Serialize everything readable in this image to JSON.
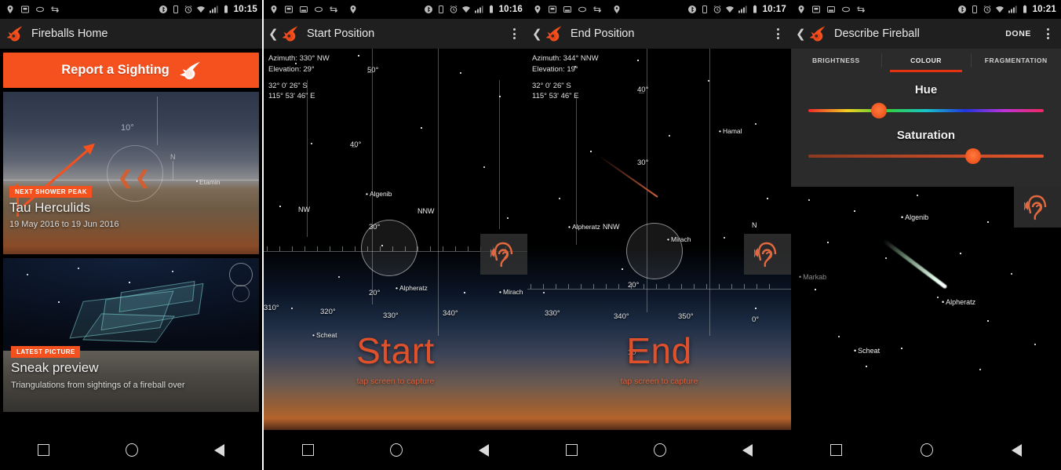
{
  "panels": [
    {
      "id": "fireballs-home",
      "statusbar": {
        "time": "10:15",
        "icons_left": [
          "location-icon",
          "sd-card-icon",
          "usb-icon",
          "sync-icon"
        ],
        "icons_right": [
          "bluetooth-icon",
          "vibrate-icon",
          "alarm-icon",
          "wifi-icon",
          "signal-icon",
          "battery-icon"
        ]
      },
      "actionbar": {
        "title": "Fireballs Home",
        "logo": "fireball-logo-icon",
        "overflow": "overflow-menu-icon"
      },
      "report_button": {
        "label": "Report a Sighting",
        "icon": "fireball-icon",
        "color": "#f4511e"
      },
      "cards": [
        {
          "badge": "NEXT SHOWER PEAK",
          "title": "Tau Herculids",
          "subtitle": "19 May 2016 to 19 Jun 2016",
          "labels": {
            "elevation": "10°",
            "north": "N",
            "star": "Etamin"
          }
        },
        {
          "badge": "LATEST PICTURE",
          "title": "Sneak preview",
          "subtitle": "Triangulations from sightings of a fireball over"
        }
      ]
    },
    {
      "id": "start-position",
      "statusbar": {
        "time": "10:16"
      },
      "actionbar": {
        "title": "Start Position",
        "back": "back-chevron-icon",
        "logo": "fireball-logo-icon",
        "overflow": "overflow-menu-icon"
      },
      "coords": {
        "azimuth": "Azimuth: 330° NW",
        "elevation": "Elevation: 29°",
        "latitude": "32° 0' 26\" S",
        "longitude": "115° 53' 46\" E"
      },
      "compass_labels": [
        "NW",
        "NNW"
      ],
      "azimuth_ticks": [
        "310°",
        "320°",
        "330°",
        "340°"
      ],
      "elevation_ticks": [
        "50°",
        "40°",
        "30°",
        "20°"
      ],
      "stars": [
        "Algenib",
        "Alpheratz",
        "Scheat",
        "Mirach"
      ],
      "action": {
        "label": "Start",
        "hint": "tap screen to capture"
      },
      "ear_icon": "sound-ear-icon"
    },
    {
      "id": "end-position",
      "statusbar": {
        "time": "10:17"
      },
      "actionbar": {
        "title": "End Position",
        "back": "back-chevron-icon",
        "logo": "fireball-logo-icon",
        "overflow": "overflow-menu-icon"
      },
      "coords": {
        "azimuth": "Azimuth: 344° NNW",
        "elevation": "Elevation: 19°",
        "latitude": "32° 0' 26\" S",
        "longitude": "115° 53' 46\" E"
      },
      "compass_labels": [
        "NNW",
        "N"
      ],
      "azimuth_ticks": [
        "330°",
        "340°",
        "350°",
        "0°"
      ],
      "elevation_ticks": [
        "40°",
        "30°",
        "20°",
        "10°"
      ],
      "stars": [
        "Hamal",
        "Alpheratz",
        "Mirach"
      ],
      "action": {
        "label": "End",
        "hint": "tap screen to capture"
      },
      "ear_icon": "sound-ear-icon"
    },
    {
      "id": "describe-fireball",
      "statusbar": {
        "time": "10:21"
      },
      "actionbar": {
        "title": "Describe Fireball",
        "back": "back-chevron-icon",
        "logo": "fireball-logo-icon",
        "done": "DONE",
        "overflow": "overflow-menu-icon"
      },
      "tabs": [
        {
          "label": "BRIGHTNESS",
          "active": false
        },
        {
          "label": "COLOUR",
          "active": true
        },
        {
          "label": "FRAGMENTATION",
          "active": false
        }
      ],
      "tab_indicator_color": "#e53212",
      "sliders": [
        {
          "label": "Hue",
          "value_percent": 30,
          "type": "hue"
        },
        {
          "label": "Saturation",
          "value_percent": 70,
          "type": "saturation"
        }
      ],
      "preview_stars": [
        "Algenib",
        "Markab",
        "Alpheratz",
        "Scheat"
      ],
      "ear_icon": "sound-ear-icon"
    }
  ],
  "navbar": {
    "buttons": [
      "recents-square-icon",
      "home-circle-icon",
      "back-triangle-icon"
    ]
  }
}
